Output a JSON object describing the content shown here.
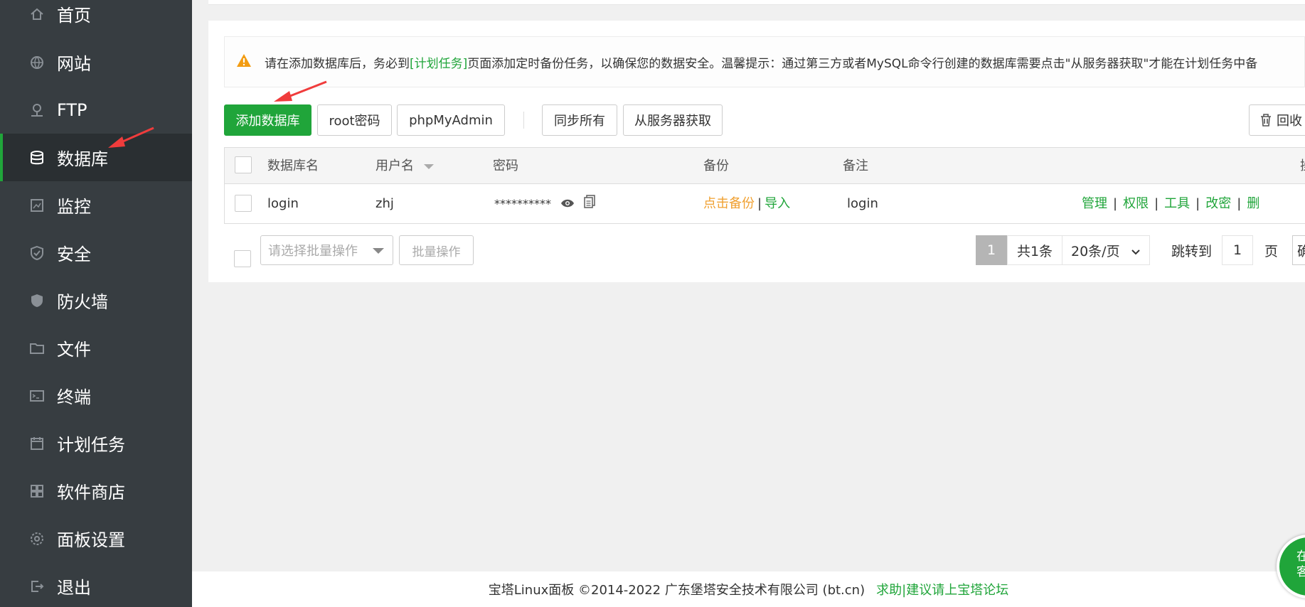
{
  "colors": {
    "accent": "#20a53a",
    "sidebar": "#373d41",
    "warn": "#f39c12",
    "backup": "#f0a030"
  },
  "sidebar": {
    "items": [
      {
        "label": "首页",
        "icon": "home-icon"
      },
      {
        "label": "网站",
        "icon": "globe-icon"
      },
      {
        "label": "FTP",
        "icon": "ftp-icon"
      },
      {
        "label": "数据库",
        "icon": "database-icon",
        "active": true
      },
      {
        "label": "监控",
        "icon": "monitor-icon"
      },
      {
        "label": "安全",
        "icon": "shield-icon"
      },
      {
        "label": "防火墙",
        "icon": "firewall-icon"
      },
      {
        "label": "文件",
        "icon": "folder-icon"
      },
      {
        "label": "终端",
        "icon": "terminal-icon"
      },
      {
        "label": "计划任务",
        "icon": "calendar-icon"
      },
      {
        "label": "软件商店",
        "icon": "apps-icon"
      },
      {
        "label": "面板设置",
        "icon": "gear-icon"
      },
      {
        "label": "退出",
        "icon": "logout-icon"
      }
    ]
  },
  "alert": {
    "text_before": "请在添加数据库后，务必到",
    "link": "[计划任务]",
    "text_after": "页面添加定时备份任务，以确保您的数据安全。温馨提示：通过第三方或者MySQL命令行创建的数据库需要点击\"从服务器获取\"才能在计划任务中备"
  },
  "toolbar": {
    "add_db": "添加数据库",
    "root_pwd": "root密码",
    "phpmyadmin": "phpMyAdmin",
    "sync_all": "同步所有",
    "get_from_server": "从服务器获取",
    "recycle": "回收"
  },
  "table": {
    "headers": {
      "name": "数据库名",
      "user": "用户名",
      "password": "密码",
      "backup": "备份",
      "remark": "备注",
      "ops": "操"
    },
    "rows": [
      {
        "name": "login",
        "user": "zhj",
        "password": "**********",
        "backup_link": "点击备份",
        "import_link": "导入",
        "remark": "login",
        "actions": [
          "管理",
          "权限",
          "工具",
          "改密",
          "删"
        ]
      }
    ]
  },
  "batch": {
    "select_placeholder": "请选择批量操作",
    "button": "批量操作"
  },
  "pagination": {
    "current_page": "1",
    "total": "共1条",
    "per_page": "20条/页",
    "jump_label": "跳转到",
    "jump_value": "1",
    "page_unit": "页",
    "confirm": "确"
  },
  "footer": {
    "copyright": "宝塔Linux面板 ©2014-2022 广东堡塔安全技术有限公司 (bt.cn)",
    "help_link": "求助|建议请上宝塔论坛"
  },
  "chat": {
    "line1": "在",
    "line2": "客"
  }
}
